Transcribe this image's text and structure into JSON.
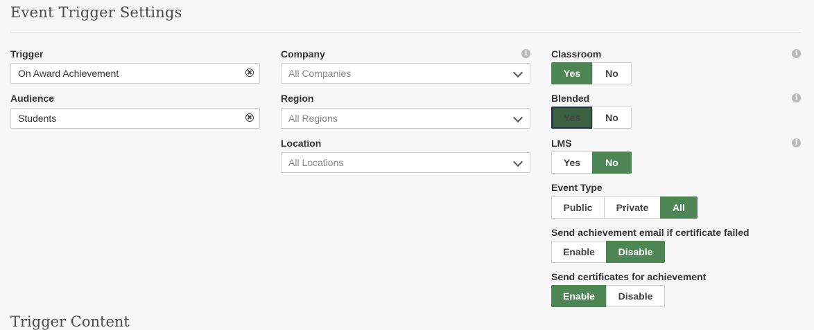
{
  "page": {
    "title": "Event Trigger Settings",
    "next_section_title": "Trigger Content"
  },
  "trigger": {
    "label": "Trigger",
    "value": "On Award Achievement"
  },
  "audience": {
    "label": "Audience",
    "value": "Students"
  },
  "company": {
    "label": "Company",
    "placeholder": "All Companies"
  },
  "region": {
    "label": "Region",
    "placeholder": "All Regions"
  },
  "location": {
    "label": "Location",
    "placeholder": "All Locations"
  },
  "classroom": {
    "label": "Classroom",
    "options": [
      "Yes",
      "No"
    ],
    "selected": "Yes"
  },
  "blended": {
    "label": "Blended",
    "options": [
      "Yes",
      "No"
    ],
    "selected": "Yes"
  },
  "lms": {
    "label": "LMS",
    "options": [
      "Yes",
      "No"
    ],
    "selected": "No"
  },
  "event_type": {
    "label": "Event Type",
    "options": [
      "Public",
      "Private",
      "All"
    ],
    "selected": "All"
  },
  "send_email_failed": {
    "label": "Send achievement email if certificate failed",
    "options": [
      "Enable",
      "Disable"
    ],
    "selected": "Disable"
  },
  "send_certificates": {
    "label": "Send certificates for achievement",
    "options": [
      "Enable",
      "Disable"
    ],
    "selected": "Enable"
  },
  "icons": {
    "info": "i"
  },
  "colors": {
    "accent": "#4e8554",
    "focused": "#3a6140"
  }
}
